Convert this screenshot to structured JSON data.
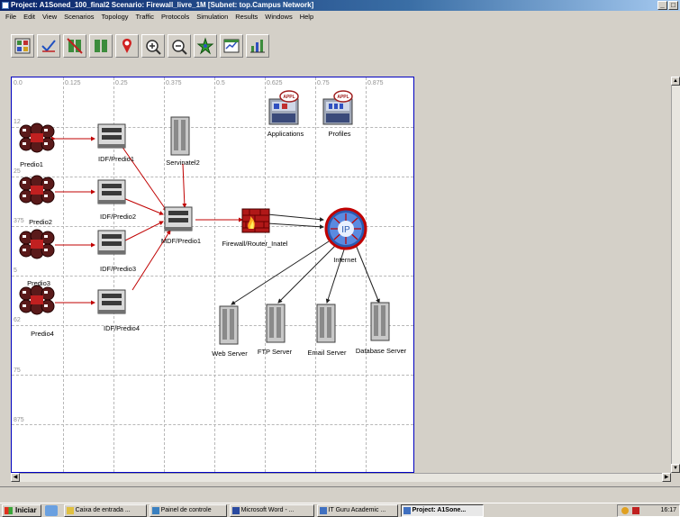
{
  "window": {
    "title": "Project: A1Soned_100_final2 Scenario: Firewall_livre_1M [Subnet: top.Campus Network]",
    "controls": [
      "_",
      "□"
    ]
  },
  "menu": [
    "File",
    "Edit",
    "View",
    "Scenarios",
    "Topology",
    "Traffic",
    "Protocols",
    "Simulation",
    "Results",
    "Windows",
    "Help"
  ],
  "toolbar": {
    "buttons": [
      "open-object-palette",
      "check-link-consistency",
      "fail-node",
      "recover-node",
      "return-to-parent",
      "zoom-in",
      "zoom-out",
      "configure-discrete-event-simulation",
      "view-simulation-results",
      "hide-or-show-graphs"
    ]
  },
  "ruler": {
    "x": [
      "0.0",
      "0.125",
      "0.25",
      "0.375",
      "0.5",
      "0.625",
      "0.75",
      "0.875"
    ],
    "y": [
      "12",
      "25",
      "375",
      "5",
      "62",
      "75",
      "875"
    ]
  },
  "nodes": {
    "predio1": "Predio1",
    "predio2": "Predio2",
    "predio3": "Predio3",
    "predio4": "Predio4",
    "idf1": "IDF/Predio1",
    "idf2": "IDF/Predio2",
    "idf3": "IDF/Predio3",
    "idf4": "IDF/Predio4",
    "mdf": "MDF/Predio1",
    "servinatel": "Servinatel2",
    "firewall": "Firewall/Router_Inatel",
    "internet": "Internet",
    "applications": "Applications",
    "profiles": "Profiles",
    "web": "Web Server",
    "ftp": "FTP Server",
    "email": "Email Server",
    "database": "Database Server"
  },
  "icon_text": {
    "appl": "APPL",
    "ip": "IP"
  },
  "taskbar": {
    "start": "Iniciar",
    "items": [
      "Caixa de entrada ...",
      "Painel de controle",
      "Microsoft Word - ...",
      "IT Guru Academic ...",
      "Project: A1Sone..."
    ],
    "clock": "16:17"
  },
  "colors": {
    "link_red": "#c00000",
    "link_black": "#202020",
    "workspace_border": "#0000c0"
  }
}
